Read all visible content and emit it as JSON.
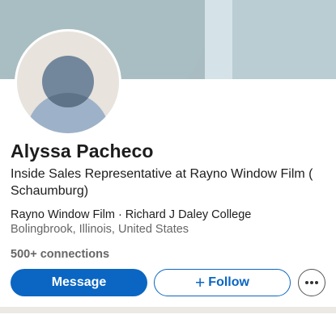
{
  "profile": {
    "name": "Alyssa Pacheco",
    "headline": "Inside Sales Representative at Rayno Window Film ( Schaumburg)",
    "companies": "Rayno Window Film · Richard J Daley College",
    "location": "Bolingbrook, Illinois, United States",
    "connections": "500+ connections"
  },
  "actions": {
    "message_label": "Message",
    "follow_label": "Follow",
    "follow_icon": "+",
    "more_icon": "more-horizontal-icon"
  },
  "colors": {
    "primary_blue": "#0a66c2",
    "text_primary": "#1d1d1d",
    "text_secondary": "#666666",
    "cover_base": "#a8bcc1"
  }
}
